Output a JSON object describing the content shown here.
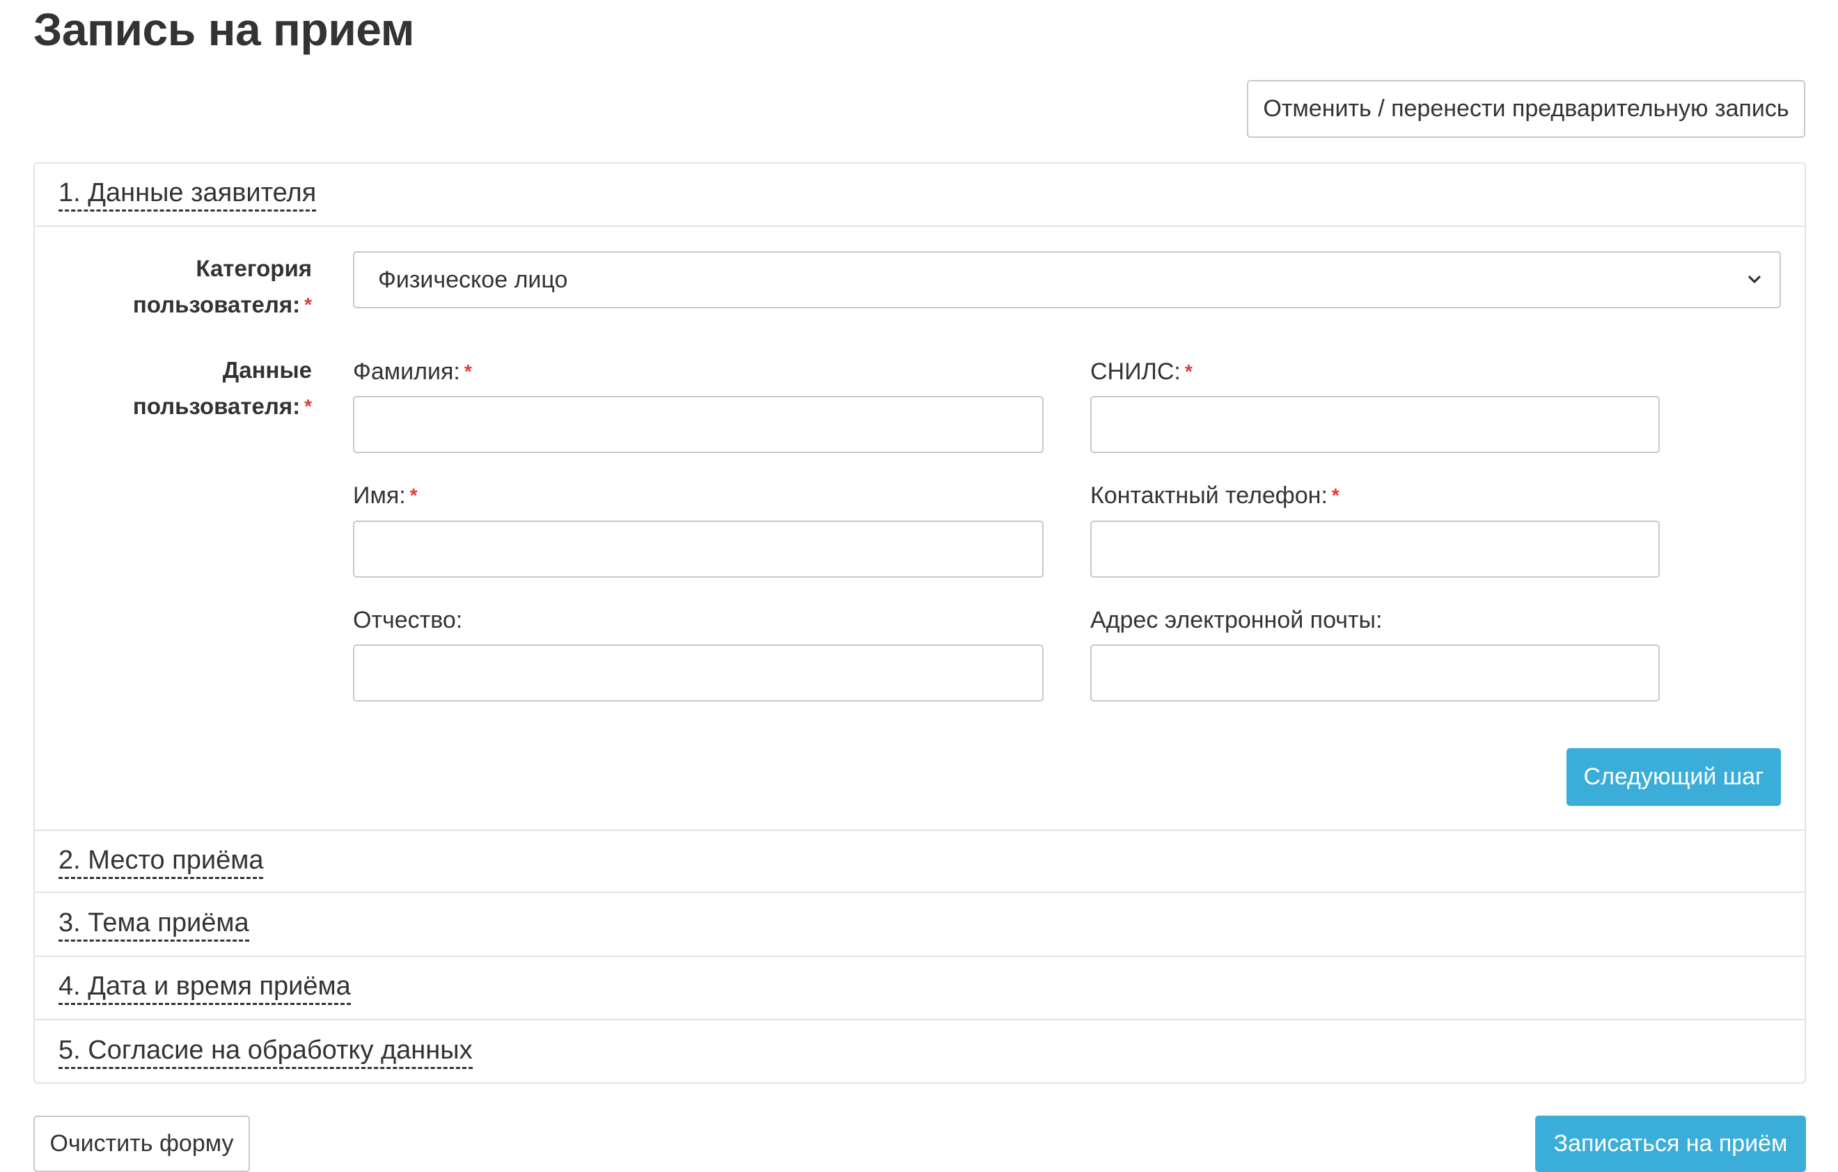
{
  "page": {
    "title": "Запись на прием"
  },
  "toolbar": {
    "cancel_label": "Отменить / перенести предварительную запись"
  },
  "sections": [
    {
      "title": "1. Данные заявителя"
    },
    {
      "title": "2. Место приёма"
    },
    {
      "title": "3. Тема приёма"
    },
    {
      "title": "4. Дата и время приёма"
    },
    {
      "title": "5. Согласие на обработку данных"
    }
  ],
  "applicant": {
    "category_label_line1": "Категория",
    "category_label_line2": "пользователя:",
    "category_value": "Физическое лицо",
    "data_label_line1": "Данные",
    "data_label_line2": "пользователя:",
    "required_mark": "*",
    "fields": {
      "surname": {
        "label": "Фамилия:",
        "value": "",
        "required": true
      },
      "snils": {
        "label": "СНИЛС:",
        "value": "",
        "required": true
      },
      "name": {
        "label": "Имя:",
        "value": "",
        "required": true
      },
      "phone": {
        "label": "Контактный телефон:",
        "value": "",
        "required": true
      },
      "patronymic": {
        "label": "Отчество:",
        "value": "",
        "required": false
      },
      "email": {
        "label": "Адрес электронной почты:",
        "value": "",
        "required": false
      }
    },
    "next_label": "Следующий шаг"
  },
  "footer": {
    "clear_label": "Очистить форму",
    "submit_label": "Записаться на приём"
  },
  "colors": {
    "primary": "#3aaed8",
    "required": "#e53935",
    "border": "#c8c8c8",
    "text": "#333333"
  }
}
